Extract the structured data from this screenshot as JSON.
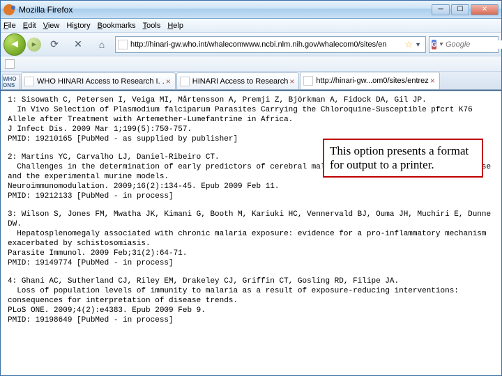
{
  "window": {
    "title": "Mozilla Firefox"
  },
  "menu": {
    "file": "File",
    "edit": "Edit",
    "view": "View",
    "history": "History",
    "bookmarks": "Bookmarks",
    "tools": "Tools",
    "help": "Help"
  },
  "address": {
    "url": "http://hinari-gw.who.int/whalecomwww.ncbi.nlm.nih.gov/whalecom0/sites/en",
    "search_placeholder": "Google"
  },
  "tabs": {
    "mini": "WHO ONS",
    "items": [
      {
        "label": "WHO  HINARI Access to Research I. ."
      },
      {
        "label": "HINARI Access to Research"
      },
      {
        "label": "http://hinari-gw...om0/sites/entrez"
      }
    ]
  },
  "records": [
    {
      "n": "1",
      "authors": "Sisowath C, Petersen I, Veiga MI, Mårtensson A, Premji Z, Björkman A, Fidock DA, Gil JP.",
      "title": "In Vivo Selection of Plasmodium falciparum Parasites Carrying the Chloroquine-Susceptible pfcrt K76 Allele after Treatment with Artemether-Lumefantrine in Africa.",
      "cite": "J Infect Dis. 2009 Mar 1;199(5):750-757.",
      "pmid": "PMID: 19210165 [PubMed - as supplied by publisher]"
    },
    {
      "n": "2",
      "authors": "Martins YC, Carvalho LJ, Daniel-Ribeiro CT.",
      "title": "Challenges in the determination of early predictors of cerebral malaria: lessons from the human disease and the experimental murine models.",
      "cite": "Neuroimmunomodulation. 2009;16(2):134-45. Epub 2009 Feb 11.",
      "pmid": "PMID: 19212133 [PubMed - in process]"
    },
    {
      "n": "3",
      "authors": "Wilson S, Jones FM, Mwatha JK, Kimani G, Booth M, Kariuki HC, Vennervald BJ, Ouma JH, Muchiri E, Dunne DW.",
      "title": "Hepatosplenomegaly associated with chronic malaria exposure: evidence for a pro-inflammatory mechanism exacerbated by schistosomiasis.",
      "cite": "Parasite Immunol. 2009 Feb;31(2):64-71.",
      "pmid": "PMID: 19149774 [PubMed - in process]"
    },
    {
      "n": "4",
      "authors": "Ghani AC, Sutherland CJ, Riley EM, Drakeley CJ, Griffin CT, Gosling RD, Filipe JA.",
      "title": "Loss of population levels of immunity to malaria as a result of exposure-reducing interventions: consequences for interpretation of disease trends.",
      "cite": "PLoS ONE. 2009;4(2):e4383. Epub 2009 Feb 9.",
      "pmid": "PMID: 19198649 [PubMed - in process]"
    }
  ],
  "callout": {
    "text": "This option presents a format for output to a printer."
  }
}
